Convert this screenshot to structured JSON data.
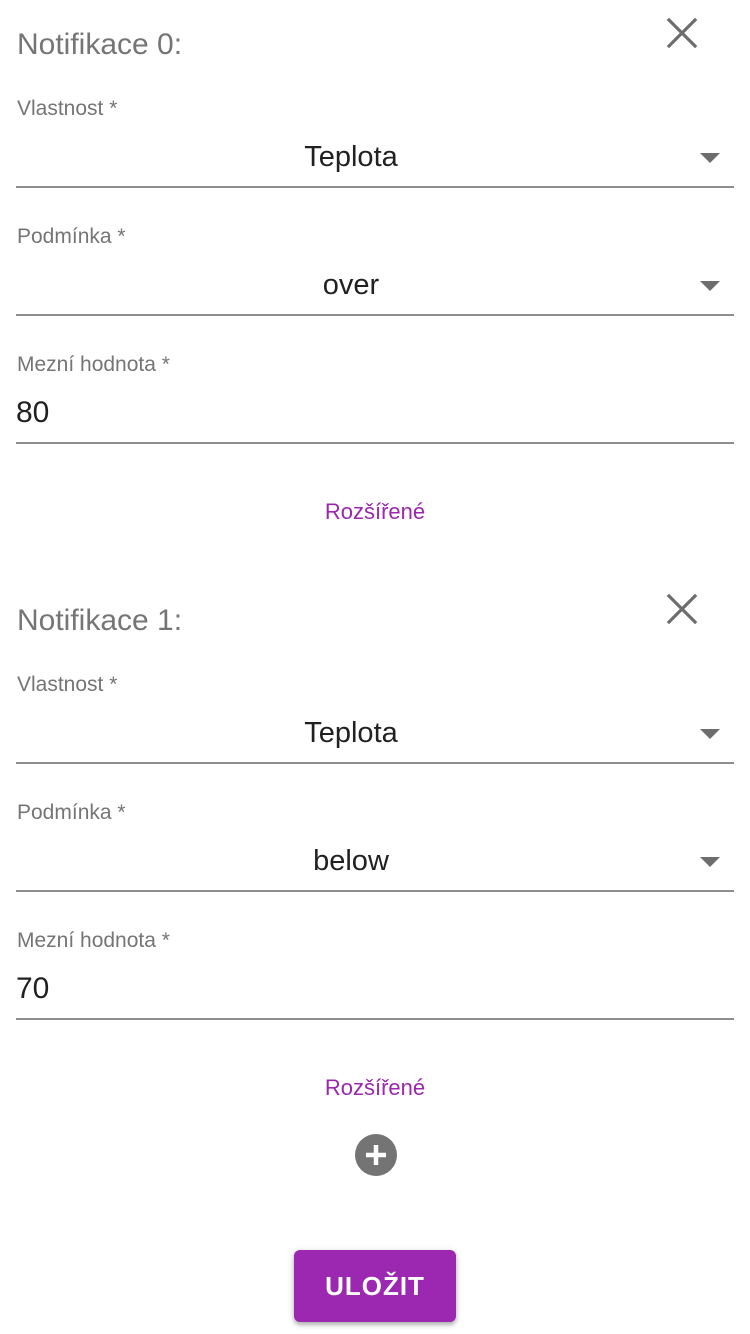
{
  "notifications": [
    {
      "title": "Notifikace 0:",
      "property": {
        "label": "Vlastnost *",
        "value": "Teplota"
      },
      "condition": {
        "label": "Podmínka *",
        "value": "over"
      },
      "threshold": {
        "label": "Mezní hodnota *",
        "value": "80"
      },
      "advanced_label": "Rozšířené"
    },
    {
      "title": "Notifikace 1:",
      "property": {
        "label": "Vlastnost *",
        "value": "Teplota"
      },
      "condition": {
        "label": "Podmínka *",
        "value": "below"
      },
      "threshold": {
        "label": "Mezní hodnota *",
        "value": "70"
      },
      "advanced_label": "Rozšířené"
    }
  ],
  "actions": {
    "save_label": "ULOŽIT",
    "add_icon": "plus-circle-icon",
    "remove_icon": "close-icon"
  },
  "colors": {
    "accent": "#9c27b0",
    "heading": "#757575",
    "text": "#212121",
    "underline": "#8e8e8e",
    "add_button": "#747474"
  }
}
